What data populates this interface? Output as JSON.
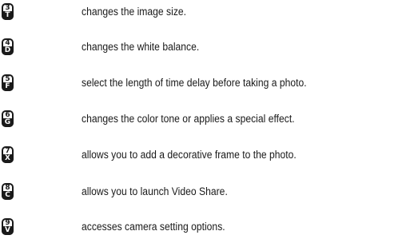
{
  "keys": [
    {
      "number": "3",
      "letter": "T",
      "description": "changes the image size."
    },
    {
      "number": "4",
      "letter": "D",
      "description": "changes the white balance."
    },
    {
      "number": "5",
      "letter": "F",
      "description": "select the length of time delay before taking a photo."
    },
    {
      "number": "6",
      "letter": "G",
      "description": "changes the color tone or applies a special effect."
    },
    {
      "number": "7",
      "letter": "X",
      "description": "allows you to add a decorative frame to the photo."
    },
    {
      "number": "8",
      "letter": "C",
      "description": "allows you to launch Video Share."
    },
    {
      "number": "9",
      "letter": "V",
      "description": "accesses camera setting options."
    }
  ]
}
